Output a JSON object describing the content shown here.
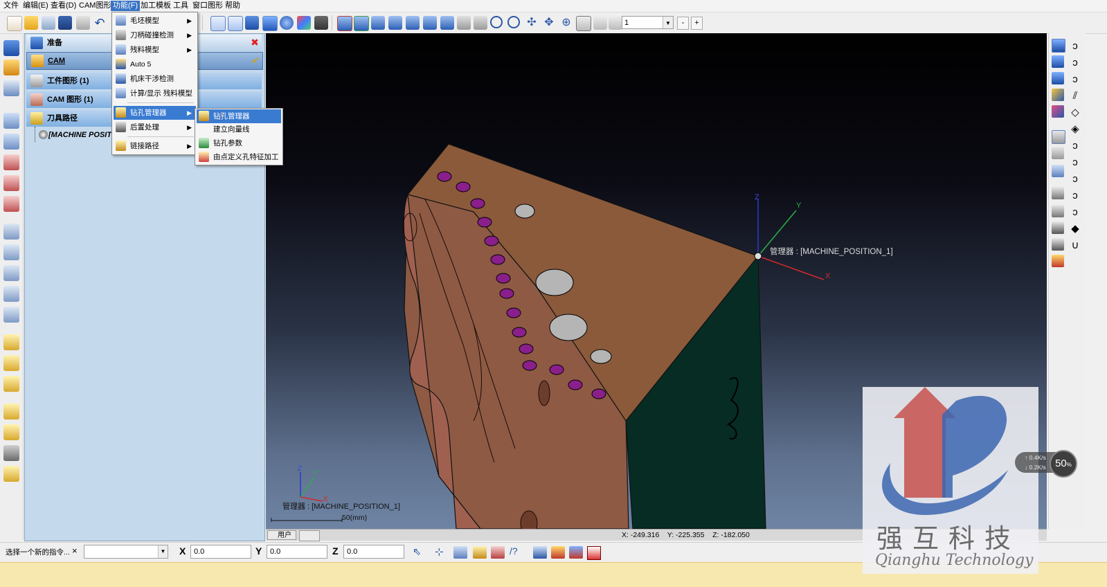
{
  "menubar": {
    "items": [
      "文件",
      "编辑(E)",
      "查看(D)",
      "CAM图形",
      "功能(F)",
      "加工模板",
      "工具",
      "窗口图形",
      "帮助"
    ],
    "active": "功能(F)"
  },
  "toolbar": {
    "layer_value": "1",
    "minus_label": "-",
    "plus_label": "+"
  },
  "tree": {
    "rows": [
      {
        "label": "准备",
        "icon": "prepare-icon"
      },
      {
        "label": "CAM",
        "icon": "cam-icon"
      },
      {
        "label": "工件图形 (1)",
        "icon": "workpiece-icon"
      },
      {
        "label": "CAM 图形 (1)",
        "icon": "cam-graphic-icon"
      },
      {
        "label": "刀具路径",
        "icon": "toolpath-icon"
      },
      {
        "label": "[MACHINE POSITI",
        "icon": "machine-position-icon"
      }
    ]
  },
  "function_menu": {
    "items": [
      {
        "label": "毛坯模型",
        "icon": "stock-model-icon",
        "submenu": true
      },
      {
        "label": "刀柄碰撞检测",
        "icon": "holder-collision-icon",
        "submenu": true
      },
      {
        "label": "残料模型",
        "icon": "rest-model-icon",
        "submenu": true
      },
      {
        "label": "Auto 5",
        "icon": "auto5-icon",
        "submenu": false
      },
      {
        "label": "机床干涉检测",
        "icon": "machine-interference-icon",
        "submenu": false
      },
      {
        "label": "计算/显示 残料模型",
        "icon": "calc-rest-model-icon",
        "submenu": false
      },
      {
        "label": "钻孔管理器",
        "icon": "drill-manager-icon",
        "submenu": true
      },
      {
        "label": "后置处理",
        "icon": "post-process-icon",
        "submenu": true
      },
      {
        "label": "链接路径",
        "icon": "link-path-icon",
        "submenu": true
      }
    ]
  },
  "drill_submenu": {
    "items": [
      {
        "label": "钻孔管理器",
        "icon": "drill-manager-icon"
      },
      {
        "label": "建立向量线",
        "icon": ""
      },
      {
        "label": "钻孔参数",
        "icon": "drill-params-icon"
      },
      {
        "label": "由点定义孔特征加工",
        "icon": "point-hole-feature-icon"
      }
    ]
  },
  "viewport": {
    "coord_label": "管理器 : [MACHINE_POSITION_1]",
    "axis_x": "X",
    "axis_y": "Y",
    "axis_z": "Z",
    "mini_coord_label": "管理器 : [MACHINE_POSITION_1]",
    "scale_label": "50(mm)"
  },
  "status": {
    "tab_user": "用户",
    "coords": "X: -249.316    Y: -225.355    Z: -182.050"
  },
  "command": {
    "prompt": "选择一个新的指令...",
    "close": "×",
    "x_label": "X",
    "x_value": "0.0",
    "y_label": "Y",
    "y_value": "0.0",
    "z_label": "Z",
    "z_value": "0.0"
  },
  "watermark": {
    "brand_cn": "强互科技",
    "brand_en": "Qianghu Technology"
  },
  "speed_widget": {
    "up": "↑ 0.4K/s",
    "down": "↓ 0.2K/s",
    "percent": "50",
    "percent_unit": "%"
  },
  "colors": {
    "menu_active": "#3873c4",
    "tree_bg": "#c4d9ec",
    "part_top": "#8a5a3b",
    "part_side_dark": "#062c24",
    "part_body": "#8e5a44",
    "hole_small": "#8a1f8c",
    "hole_large": "#b5b5b5"
  }
}
